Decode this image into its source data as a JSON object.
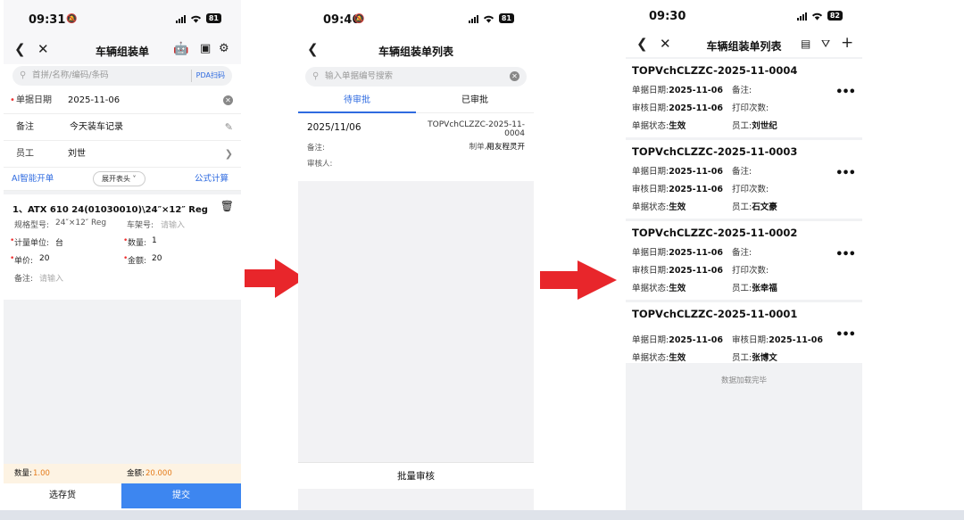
{
  "p1": {
    "time": "09:31",
    "battery": "81",
    "title": "车辆组装单",
    "search_placeholder": "首拼/名称/编码/条码",
    "pda": "PDA扫码",
    "date_label": "单据日期",
    "date_value": "2025-11-06",
    "note_label": "备注",
    "note_value": "今天装车记录",
    "emp_label": "员工",
    "emp_value": "刘世",
    "ai": "AI智能开单",
    "expand": "展开表头",
    "formula": "公式计算",
    "item_title": "1、ATX 610 24(01030010)\\24″×12″ Reg",
    "spec_label": "规格型号:",
    "spec_value": "24″×12″ Reg",
    "rack_label": "车架号:",
    "rack_ph": "请输入",
    "unit_label": "计量单位:",
    "unit_value": "台",
    "qty_label": "数量:",
    "qty_value": "1",
    "price_label": "单价:",
    "price_value": "20",
    "amount_label": "金额:",
    "amount_value": "20",
    "memo_label": "备注:",
    "memo_ph": "请输入",
    "sum_qty_label": "数量:",
    "sum_qty": "1.00",
    "sum_amt_label": "金额:",
    "sum_amt": "20.000",
    "pick": "选存货",
    "submit": "提交"
  },
  "p2": {
    "time": "09:46",
    "battery": "81",
    "title": "车辆组装单列表",
    "search_placeholder": "输入单据编号搜索",
    "tab1": "待审批",
    "tab2": "已审批",
    "date": "2025/11/06",
    "code1": "TOPVchCLZZC-2025-11-",
    "code2": "0004",
    "note_label": "备注:",
    "maker_label": "制单人:",
    "maker": "用友程灵开",
    "auditor_label": "审核人:",
    "batch": "批量审核"
  },
  "p3": {
    "time": "09:30",
    "battery": "82",
    "title": "车辆组装单列表",
    "loaded": "数据加载完毕",
    "cards": [
      {
        "code": "TOPVchCLZZC-2025-11-0004",
        "date": "2025-11-06",
        "audit": "2025-11-06",
        "status": "生效",
        "emp": "刘世纪"
      },
      {
        "code": "TOPVchCLZZC-2025-11-0003",
        "date": "2025-11-06",
        "audit": "2025-11-06",
        "status": "生效",
        "emp": "石文豪"
      },
      {
        "code": "TOPVchCLZZC-2025-11-0002",
        "date": "2025-11-06",
        "audit": "2025-11-06",
        "status": "生效",
        "emp": "张幸福"
      },
      {
        "code": "TOPVchCLZZC-2025-11-0001",
        "date": "2025-11-06",
        "audit": "2025-11-06",
        "status": "生效",
        "emp": "张博文"
      }
    ],
    "l_date": "单据日期:",
    "l_audit": "审核日期:",
    "l_status": "单据状态:",
    "l_note": "备注:",
    "l_print": "打印次数:",
    "l_emp": "员工:"
  },
  "colors": {
    "accent": "#2f6be0",
    "arrow": "#e8262b",
    "submit_bg": "#3d86f0",
    "summary_bg": "#fdf3e3"
  }
}
